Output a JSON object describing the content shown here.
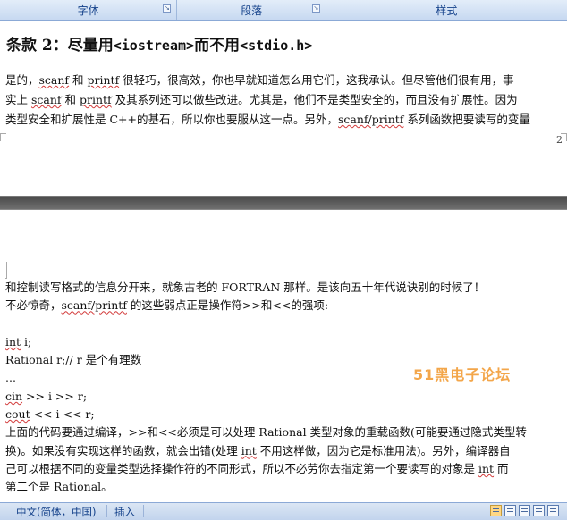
{
  "ribbon": {
    "groups": [
      {
        "label": "字体"
      },
      {
        "label": "段落"
      },
      {
        "label": "样式"
      }
    ]
  },
  "page1": {
    "heading_prefix": "条款 2：尽量用",
    "heading_code1": "<iostream>",
    "heading_mid": "而不用",
    "heading_code2": "<stdio.h>",
    "lines": [
      [
        "是的，",
        "scanf",
        " 和 ",
        "printf",
        " 很轻巧，很高效，你也早就知道怎么用它们，这我承认。但尽管他们很有用，事"
      ],
      [
        "实上 ",
        "scanf",
        " 和 ",
        "printf",
        " 及其系列还可以做些改进。尤其是，他们不是类型安全的，而且没有扩展性。因为"
      ],
      [
        "类型安全和扩展性是 C++的基石，所以你也要服从这一点。另外，",
        "scanf/printf",
        " 系列函数把要读写的变量"
      ]
    ],
    "page_number": "2"
  },
  "page2": {
    "line1": "和控制读写格式的信息分开来，就象古老的 FORTRAN 那样。是该向五十年代说诀别的时候了！",
    "line2_a": "不必惊奇，",
    "line2_b": "scanf/printf",
    "line2_c": " 的这些弱点正是操作符>>和<<的强项:",
    "code1_a": "int",
    "code1_b": " i;",
    "code2": "Rational r;// r 是个有理数",
    "code3": "...",
    "code4_a": "cin",
    "code4_b": " >> i >> r;",
    "code5_a": "cout",
    "code5_b": " << i << r;",
    "p3_l1": "上面的代码要通过编译，>>和<<必须是可以处理 Rational 类型对象的重载函数(可能要通过隐式类型转",
    "p3_l2_a": "换)。如果没有实现这样的函数，就会出错(处理 ",
    "p3_l2_b": "int",
    "p3_l2_c": " 不用这样做，因为它是标准用法)。另外，编译器自",
    "p3_l3_a": "己可以根据不同的变量类型选择操作符的不同形式，所以不必劳你去指定第一个要读写的对象是 ",
    "p3_l3_b": "int",
    "p3_l3_c": " 而",
    "p3_l4": "第二个是 Rational。",
    "watermark": "51黑电子论坛"
  },
  "statusbar": {
    "language": "中文(简体，中国)",
    "mode": "插入"
  }
}
